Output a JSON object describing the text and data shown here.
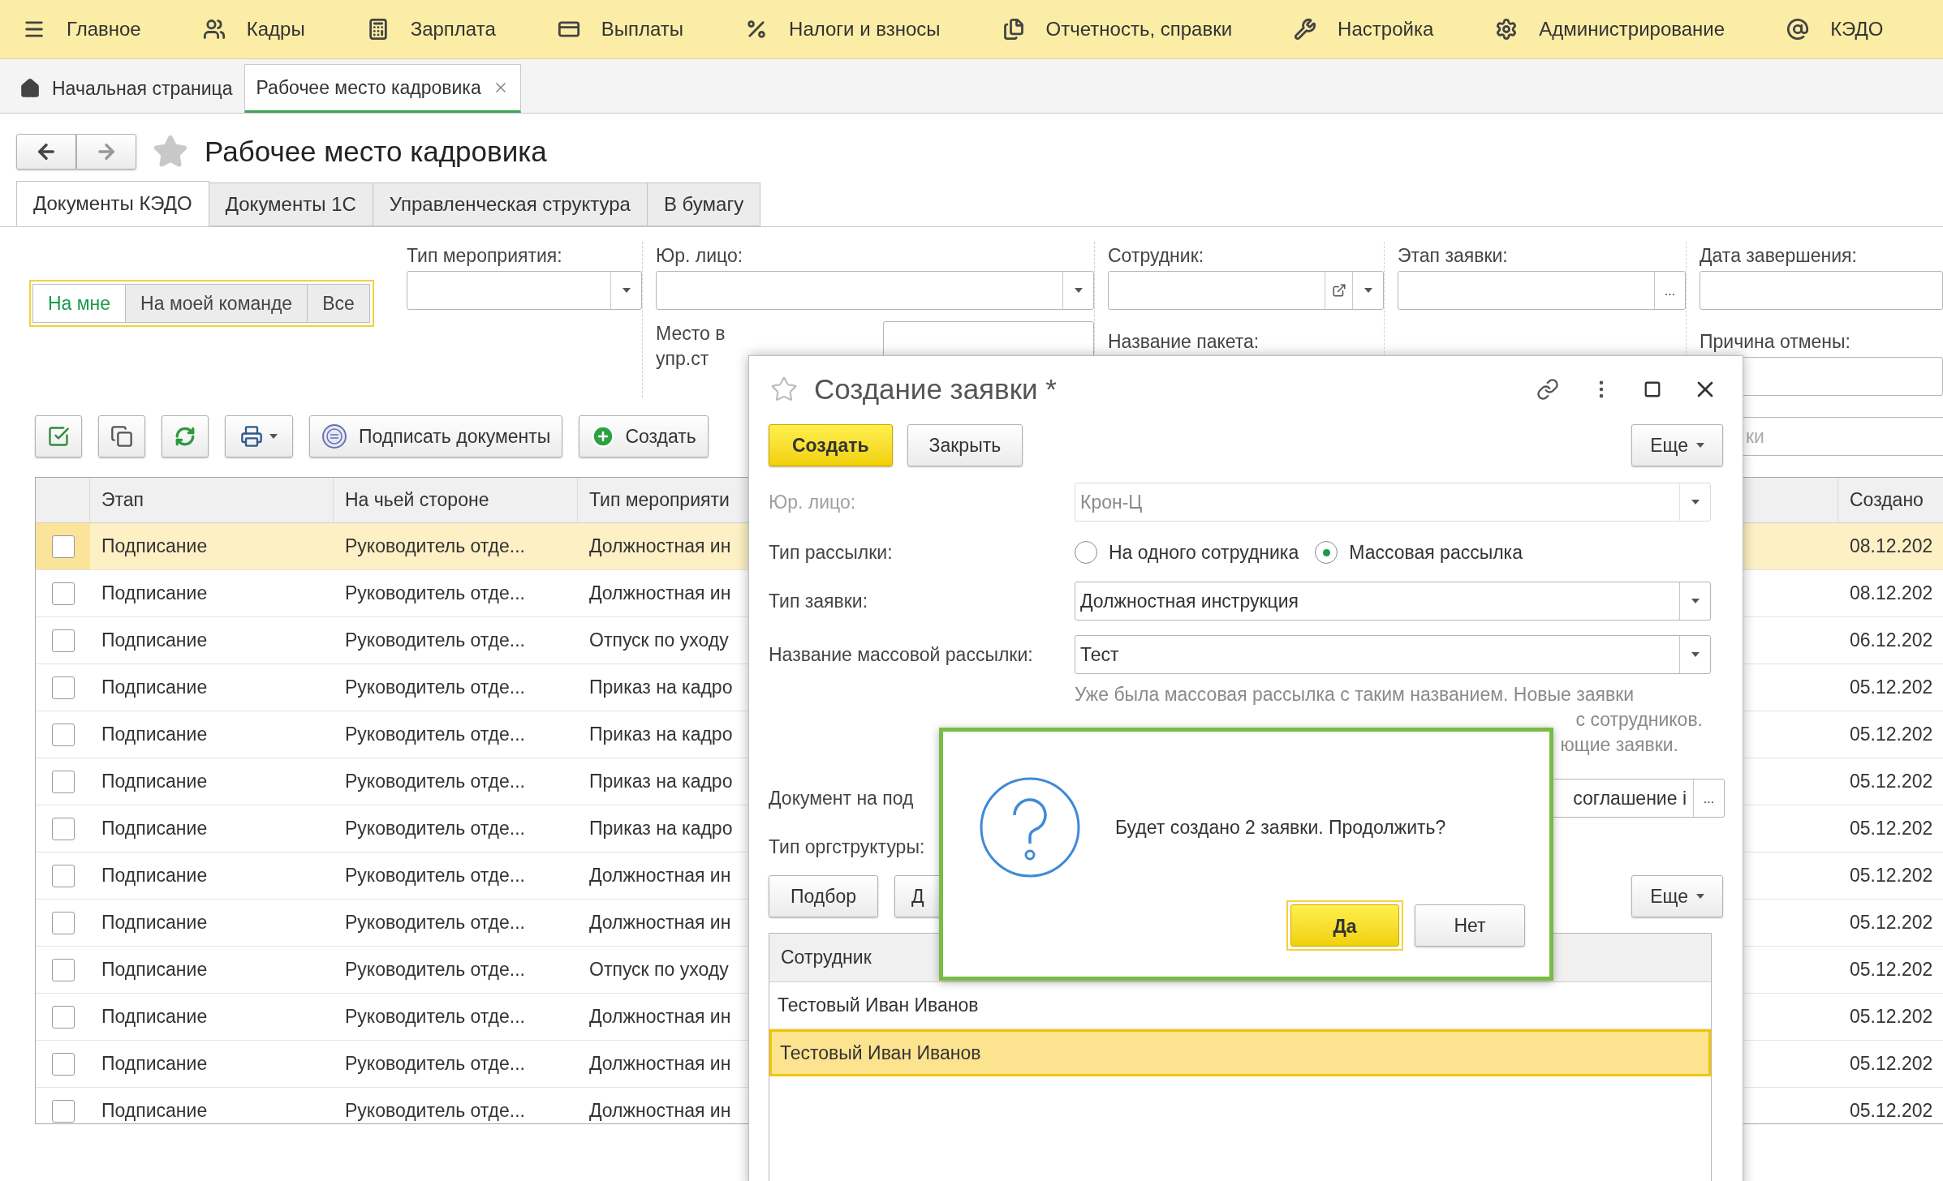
{
  "menu": [
    {
      "label": "Главное"
    },
    {
      "label": "Кадры"
    },
    {
      "label": "Зарплата"
    },
    {
      "label": "Выплаты"
    },
    {
      "label": "Налоги и взносы"
    },
    {
      "label": "Отчетность, справки"
    },
    {
      "label": "Настройка"
    },
    {
      "label": "Администрирование"
    },
    {
      "label": "КЭДО"
    }
  ],
  "open_tabs": [
    {
      "label": "Начальная страница",
      "selected": false
    },
    {
      "label": "Рабочее место кадровика",
      "selected": true
    }
  ],
  "page_title": "Рабочее место кадровика",
  "tabs": [
    {
      "label": "Документы КЭДО",
      "selected": true
    },
    {
      "label": "Документы 1С",
      "selected": false
    },
    {
      "label": "Управленческая структура",
      "selected": false
    },
    {
      "label": "В бумагу",
      "selected": false
    }
  ],
  "scope_switch": [
    {
      "label": "На мне",
      "selected": true
    },
    {
      "label": "На моей команде",
      "selected": false
    },
    {
      "label": "Все",
      "selected": false
    }
  ],
  "filters": {
    "event_type": "Тип мероприятия:",
    "legal_entity": "Юр. лицо:",
    "employee": "Сотрудник:",
    "stage": "Этап заявки:",
    "stage_select_button": "...",
    "end_date": "Дата завершения:",
    "place_lines": [
      "Место в",
      "упр.ст"
    ],
    "package_name": "Название пакета:",
    "cancel_reason": "Причина отмены:"
  },
  "toolbar": {
    "sign_button": "Подписать документы",
    "create_button": "Создать",
    "search_placeholder": "ки"
  },
  "table": {
    "columns": [
      "Этап",
      "На чьей стороне",
      "Тип мероприяти",
      "Создано"
    ],
    "rows": [
      {
        "stage": "Подписание",
        "side": "Руководитель отде...",
        "event_type": "Должностная ин",
        "created": "08.12.202",
        "checked": false,
        "selected": true
      },
      {
        "stage": "Подписание",
        "side": "Руководитель отде...",
        "event_type": "Должностная ин",
        "created": "08.12.202",
        "checked": false,
        "selected": false
      },
      {
        "stage": "Подписание",
        "side": "Руководитель отде...",
        "event_type": "Отпуск по уходу",
        "created": "06.12.202",
        "checked": false,
        "selected": false
      },
      {
        "stage": "Подписание",
        "side": "Руководитель отде...",
        "event_type": "Приказ на кадро",
        "created": "05.12.202",
        "checked": false,
        "selected": false
      },
      {
        "stage": "Подписание",
        "side": "Руководитель отде...",
        "event_type": "Приказ на кадро",
        "created": "05.12.202",
        "checked": false,
        "selected": false
      },
      {
        "stage": "Подписание",
        "side": "Руководитель отде...",
        "event_type": "Приказ на кадро",
        "created": "05.12.202",
        "checked": false,
        "selected": false
      },
      {
        "stage": "Подписание",
        "side": "Руководитель отде...",
        "event_type": "Приказ на кадро",
        "created": "05.12.202",
        "checked": false,
        "selected": false
      },
      {
        "stage": "Подписание",
        "side": "Руководитель отде...",
        "event_type": "Должностная ин",
        "created": "05.12.202",
        "checked": false,
        "selected": false
      },
      {
        "stage": "Подписание",
        "side": "Руководитель отде...",
        "event_type": "Должностная ин",
        "created": "05.12.202",
        "checked": false,
        "selected": false
      },
      {
        "stage": "Подписание",
        "side": "Руководитель отде...",
        "event_type": "Отпуск по уходу",
        "created": "05.12.202",
        "checked": false,
        "selected": false
      },
      {
        "stage": "Подписание",
        "side": "Руководитель отде...",
        "event_type": "Должностная ин",
        "created": "05.12.202",
        "checked": false,
        "selected": false
      },
      {
        "stage": "Подписание",
        "side": "Руководитель отде...",
        "event_type": "Должностная ин",
        "created": "05.12.202",
        "checked": false,
        "selected": false
      },
      {
        "stage": "Подписание",
        "side": "Руководитель отде...",
        "event_type": "Должностная ин",
        "created": "05.12.202",
        "checked": false,
        "selected": false
      }
    ]
  },
  "dialog": {
    "title": "Создание заявки *",
    "create_button": "Создать",
    "close_button": "Закрыть",
    "more_button": "Еще",
    "legal_entity": {
      "label": "Юр. лицо:",
      "value": "Крон-Ц",
      "disabled": true
    },
    "mailing_type": {
      "label": "Тип рассылки:",
      "options": [
        {
          "label": "На одного сотрудника",
          "selected": false
        },
        {
          "label": "Массовая рассылка",
          "selected": true
        }
      ]
    },
    "request_type": {
      "label": "Тип заявки:",
      "value": "Должностная инструкция"
    },
    "mass_name": {
      "label": "Название массовой рассылки:",
      "value": "Тест"
    },
    "note_lines": [
      "Уже была массовая рассылка с таким названием. Новые заявки",
      "с сотрудников.",
      "ющие заявки."
    ],
    "document": {
      "label": "Документ на под",
      "value": "соглашение і",
      "select_button": "..."
    },
    "org_type": {
      "label": "Тип оргструктуры:"
    },
    "pick_button": "Подбор",
    "second_button": "Д",
    "more_button_2": "Еще",
    "employees": {
      "column": "Сотрудник",
      "rows": [
        {
          "name": "Тестовый Иван Иванов",
          "selected": false
        },
        {
          "name": "Тестовый Иван Иванов",
          "selected": true
        }
      ]
    }
  },
  "confirm": {
    "message": "Будет создано 2 заявки. Продолжить?",
    "buttons": [
      {
        "label": "Да",
        "default": true
      },
      {
        "label": "Нет",
        "default": false
      }
    ]
  }
}
